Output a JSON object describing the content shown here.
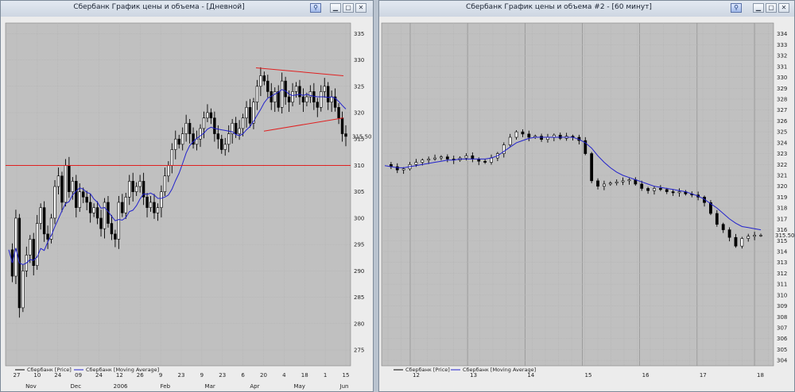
{
  "left_window": {
    "title": "Сбербанк График цены и объема - [Дневной]",
    "buttons": {
      "pin": "pin-icon",
      "minimize": "minimize-icon",
      "maximize": "maximize-icon",
      "close": "close-icon"
    }
  },
  "right_window": {
    "title": "Сбербанк График цены и объема #2 - [60 минут]",
    "buttons": {
      "pin": "pin-icon",
      "minimize": "minimize-icon",
      "maximize": "maximize-icon",
      "close": "close-icon"
    }
  },
  "chart_data": [
    {
      "type": "candlestick",
      "title": "Сбербанк График цены и объема - [Дневной]",
      "ylim": [
        272,
        337
      ],
      "yticks": [
        275,
        280,
        285,
        290,
        295,
        300,
        305,
        310,
        315,
        320,
        325,
        330,
        335
      ],
      "last_price_label": "315.50",
      "x_day_labels": [
        "27",
        "10",
        "24",
        "09",
        "24",
        "12",
        "26",
        "9",
        "23",
        "9",
        "23",
        "6",
        "20",
        "4",
        "18",
        "1",
        "15"
      ],
      "x_month_labels": [
        "Nov",
        "Dec",
        "2006",
        "Feb",
        "Mar",
        "Apr",
        "May",
        "Jun"
      ],
      "legend": [
        "Сбербанк [Price]",
        "Сбербанк [Moving Average]"
      ],
      "colors": {
        "price": "#000000",
        "moving_average": "#2222cc",
        "lines": "#e02020",
        "grid": "#b0b0b0",
        "background": "#c0c0c0"
      },
      "price_path": [
        294,
        289,
        300,
        283,
        290,
        293,
        296,
        291,
        299,
        302,
        297,
        296,
        300,
        306,
        308,
        303,
        310,
        305,
        307,
        302,
        305,
        304,
        303,
        301,
        302,
        300,
        298,
        303,
        299,
        297,
        296,
        303,
        301,
        304,
        307,
        305,
        306,
        307,
        304,
        302,
        303,
        301,
        302,
        305,
        308,
        310,
        313,
        315,
        314,
        316,
        318,
        316,
        314,
        315,
        317,
        319,
        320,
        319,
        316,
        315,
        313,
        314,
        316,
        318,
        316,
        317,
        319,
        321,
        318,
        322,
        325,
        327,
        326,
        324,
        322,
        324,
        321,
        326,
        323,
        322,
        324,
        325,
        323,
        322,
        323,
        324,
        322,
        321,
        324,
        325,
        322,
        323,
        321,
        319,
        316,
        315.5
      ],
      "horizontal_line": 310,
      "channel_upper": [
        [
          321,
          328.5
        ],
        [
          431,
          327
        ]
      ],
      "channel_lower": [
        [
          331,
          316.5
        ],
        [
          431,
          319
        ]
      ]
    },
    {
      "type": "candlestick",
      "title": "Сбербанк График цены и объема #2 - [60 минут]",
      "ylim": [
        303.5,
        335
      ],
      "yticks": [
        304,
        305,
        306,
        307,
        308,
        309,
        310,
        311,
        312,
        313,
        314,
        315,
        316,
        317,
        318,
        319,
        320,
        321,
        322,
        323,
        324,
        325,
        326,
        327,
        328,
        329,
        330,
        331,
        332,
        333,
        334
      ],
      "last_price_label": "315.50",
      "x_day_labels": [
        "12",
        "13",
        "14",
        "15",
        "16",
        "17",
        "18"
      ],
      "legend": [
        "Сбербанк [Price]",
        "Сбербанк [Moving Average]"
      ],
      "colors": {
        "price": "#000000",
        "moving_average": "#2222cc",
        "grid": "#b0b0b0",
        "background": "#c0c0c0"
      },
      "price_path": [
        322,
        321.8,
        321.5,
        321.6,
        322,
        322.2,
        322.4,
        322.5,
        322.6,
        322.7,
        322.5,
        322.4,
        322.6,
        322.8,
        322.5,
        322.3,
        322.2,
        322.6,
        323,
        323.8,
        324.5,
        325,
        324.8,
        324.5,
        324.6,
        324.3,
        324.5,
        324.7,
        324.4,
        324.6,
        324.5,
        324.2,
        323,
        320.5,
        320,
        320.2,
        320.3,
        320.4,
        320.5,
        320.6,
        320.2,
        319.8,
        319.6,
        319.8,
        319.7,
        319.5,
        319.4,
        319.5,
        319.3,
        319.2,
        319,
        318.5,
        317.5,
        316.5,
        316,
        315.3,
        314.5,
        315.2,
        315.4,
        315.5,
        315.5
      ],
      "moving_average": [
        321.9,
        321.8,
        321.7,
        321.7,
        321.8,
        321.9,
        322,
        322.1,
        322.2,
        322.3,
        322.4,
        322.4,
        322.5,
        322.5,
        322.5,
        322.5,
        322.5,
        322.6,
        322.8,
        323.2,
        323.6,
        324,
        324.2,
        324.4,
        324.5,
        324.5,
        324.5,
        324.5,
        324.5,
        324.5,
        324.5,
        324.3,
        324,
        323.5,
        322.8,
        322.2,
        321.7,
        321.3,
        321,
        320.8,
        320.6,
        320.4,
        320.2,
        320,
        319.9,
        319.8,
        319.7,
        319.6,
        319.5,
        319.3,
        319.1,
        318.8,
        318.4,
        318,
        317.5,
        317,
        316.6,
        316.3,
        316.2,
        316.1,
        316
      ]
    }
  ]
}
